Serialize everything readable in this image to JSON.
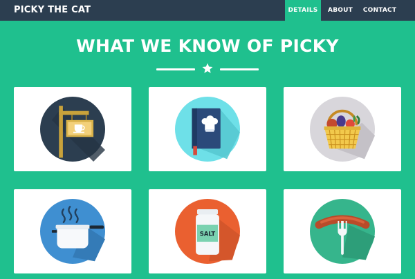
{
  "navbar": {
    "brand": "PICKY THE CAT",
    "items": [
      {
        "label": "DETAILS",
        "active": true
      },
      {
        "label": "ABOUT",
        "active": false
      },
      {
        "label": "CONTACT",
        "active": false
      }
    ]
  },
  "section": {
    "title": "WHAT WE KNOW OF PICKY",
    "divider_icon": "star-icon"
  },
  "cards": [
    {
      "icon": "cafe-sign-icon",
      "circle_color": "#2c3e50"
    },
    {
      "icon": "recipe-book-icon",
      "circle_color": "#6ee0e8"
    },
    {
      "icon": "picnic-basket-icon",
      "circle_color": "#d8d6db"
    },
    {
      "icon": "cooking-pot-icon",
      "circle_color": "#3f8fd1"
    },
    {
      "icon": "salt-jar-icon",
      "circle_color": "#ea6030",
      "label": "SALT"
    },
    {
      "icon": "sausage-fork-icon",
      "circle_color": "#36b58c"
    }
  ],
  "colors": {
    "background": "#1fc08e",
    "navbar": "#2c3e50",
    "accent": "#1fc08e",
    "text_light": "#ffffff"
  }
}
